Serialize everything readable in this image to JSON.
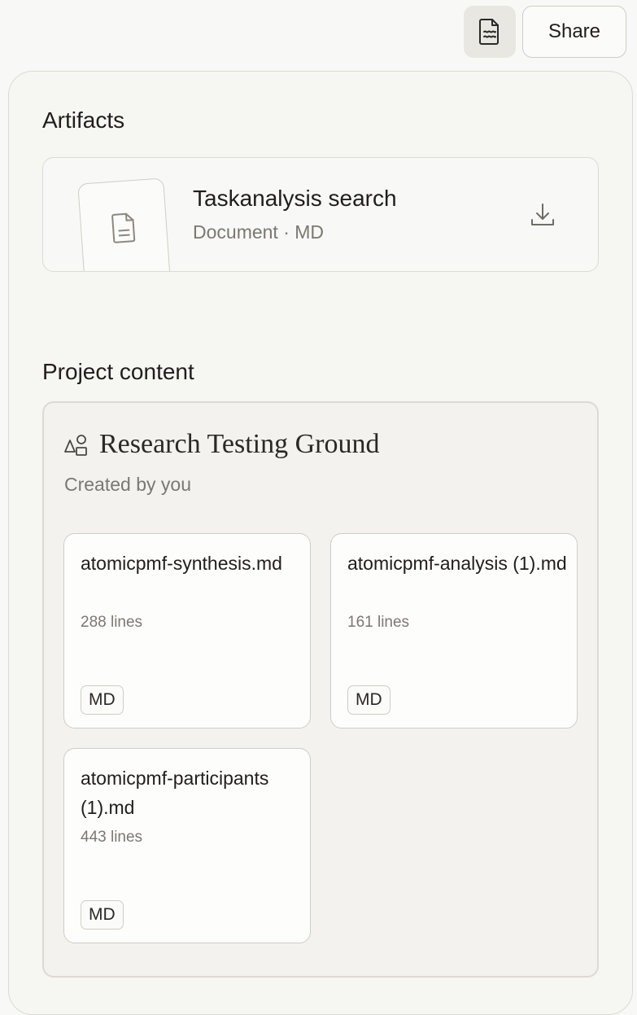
{
  "toolbar": {
    "doc_icon": "document-wave-icon",
    "share_label": "Share"
  },
  "artifacts": {
    "title": "Artifacts",
    "items": [
      {
        "title": "Taskanalysis search",
        "meta": "Document · MD",
        "icon": "document-icon",
        "action_icon": "download-icon"
      }
    ]
  },
  "project": {
    "section_title": "Project content",
    "icon": "shapes-icon",
    "name": "Research Testing Ground",
    "subtitle": "Created by you",
    "files": [
      {
        "name": "atomicpmf-synthesis.md",
        "lines": "288 lines",
        "badge": "MD"
      },
      {
        "name": "atomicpmf-analysis (1).md",
        "lines": "161 lines",
        "badge": "MD"
      },
      {
        "name": "atomicpmf-participants (1).md",
        "lines": "443 lines",
        "badge": "MD"
      }
    ]
  },
  "colors": {
    "background": "#f8f8f6",
    "panel": "#f6f6f3",
    "border": "#dcdad3",
    "muted_text": "#7a7872"
  }
}
